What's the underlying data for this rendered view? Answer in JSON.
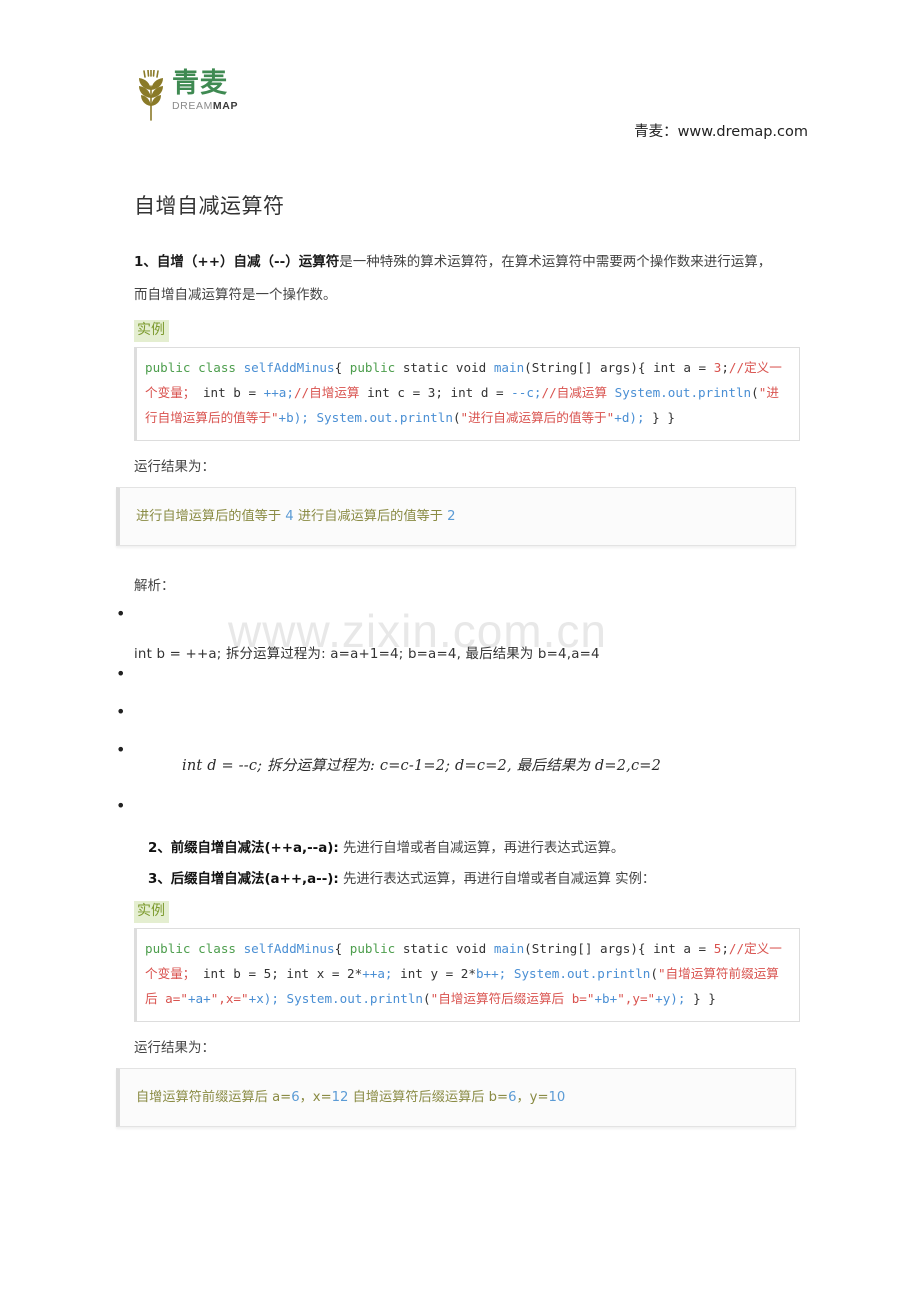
{
  "header": {
    "logo_cn": "青麦",
    "logo_en_light": "DREAM",
    "logo_en_bold": "MAP",
    "site_link": "青麦：www.dremap.com"
  },
  "watermark": "www.zixin.com.cn",
  "doc": {
    "title": "自增自减运算符",
    "intro_bold": "1、自增（++）自减（--）运算符",
    "intro_rest": "是一种特殊的算术运算符，在算术运算符中需要两个操作数来进行运算，",
    "intro_line2": "而自增自减运算符是一个操作数。",
    "example_tag": "实例",
    "result_label": "运行结果为：",
    "analysis_label": "解析："
  },
  "code1": {
    "tokens": [
      {
        "t": "public ",
        "c": "k"
      },
      {
        "t": "class ",
        "c": "k"
      },
      {
        "t": "selfAddMinus",
        "c": "cls"
      },
      {
        "t": "{ ",
        "c": "pl"
      },
      {
        "t": "public ",
        "c": "k"
      },
      {
        "t": "static ",
        "c": "pl"
      },
      {
        "t": "void ",
        "c": "pl"
      },
      {
        "t": "main",
        "c": "cls"
      },
      {
        "t": "(String[] args){ int a = ",
        "c": "pl"
      },
      {
        "t": "3",
        "c": "cm"
      },
      {
        "t": ";",
        "c": "pl"
      },
      {
        "t": "//定义一个变量；",
        "c": "cm"
      },
      {
        "t": " int b = ",
        "c": "pl"
      },
      {
        "t": "++a;",
        "c": "cls"
      },
      {
        "t": "//自增运算",
        "c": "cm"
      },
      {
        "t": " int c = 3; int d = ",
        "c": "pl"
      },
      {
        "t": "--c;",
        "c": "cls"
      },
      {
        "t": "//自减运算",
        "c": "cm"
      },
      {
        "t": " ",
        "c": "pl"
      },
      {
        "t": "System.out.println",
        "c": "cls"
      },
      {
        "t": "(",
        "c": "pl"
      },
      {
        "t": "\"进行自增运算后的值等于\"",
        "c": "cm"
      },
      {
        "t": "+b); ",
        "c": "cls"
      },
      {
        "t": "System.out.println",
        "c": "cls"
      },
      {
        "t": "(",
        "c": "pl"
      },
      {
        "t": "\"进行自减运算后的值等于\"",
        "c": "cm"
      },
      {
        "t": "+d); ",
        "c": "cls"
      },
      {
        "t": "} }",
        "c": "pl"
      }
    ],
    "plain": "public class selfAddMinus{ public static void main(String[] args){ int a = 3;//定义一个变量； int b = ++a;//自增运算 int c = 3; int d = --c;//自减运算 System.out.println(\"进行自增运算后的值等于\"+b); System.out.println(\"进行自减运算后的值等于\"+d); } }"
  },
  "result1": {
    "seg1": "进行自增运算后的值等于 ",
    "num1": "4",
    "seg2": " 进行自减运算后的值等于 ",
    "num2": "2"
  },
  "analysis": {
    "bullet1": "int b = ++a; 拆分运算过程为: a=a+1=4; b=a=4, 最后结果为 b=4,a=4",
    "bullet2": "int d = --c; 拆分运算过程为: c=c-1=2; d=c=2, 最后结果为 d=2,c=2"
  },
  "section2": {
    "bold": "2、前缀自增自减法(++a,--a):",
    "rest": " 先进行自增或者自减运算，再进行表达式运算。"
  },
  "section3": {
    "bold": "3、后缀自增自减法(a++,a--):",
    "rest": " 先进行表达式运算，再进行自增或者自减运算 实例："
  },
  "code2": {
    "tokens": [
      {
        "t": "public ",
        "c": "k"
      },
      {
        "t": "class ",
        "c": "k"
      },
      {
        "t": "selfAddMinus",
        "c": "cls"
      },
      {
        "t": "{ ",
        "c": "pl"
      },
      {
        "t": "public ",
        "c": "k"
      },
      {
        "t": "static ",
        "c": "pl"
      },
      {
        "t": "void ",
        "c": "pl"
      },
      {
        "t": "main",
        "c": "cls"
      },
      {
        "t": "(String[] args){ int a = ",
        "c": "pl"
      },
      {
        "t": "5",
        "c": "cm"
      },
      {
        "t": ";",
        "c": "pl"
      },
      {
        "t": "//定义一个变量；",
        "c": "cm"
      },
      {
        "t": " int b = 5; int x = 2*",
        "c": "pl"
      },
      {
        "t": "++a;",
        "c": "cls"
      },
      {
        "t": " int y = 2*",
        "c": "pl"
      },
      {
        "t": "b++;",
        "c": "cls"
      },
      {
        "t": " ",
        "c": "pl"
      },
      {
        "t": "System.out.println",
        "c": "cls"
      },
      {
        "t": "(",
        "c": "pl"
      },
      {
        "t": "\"自增运算符前缀运算后 a=\"",
        "c": "cm"
      },
      {
        "t": "+a+",
        "c": "cls"
      },
      {
        "t": "\",x=\"",
        "c": "cm"
      },
      {
        "t": "+x); ",
        "c": "cls"
      },
      {
        "t": "System.out.println",
        "c": "cls"
      },
      {
        "t": "(",
        "c": "pl"
      },
      {
        "t": "\"自增运算符后缀运算后 b=\"",
        "c": "cm"
      },
      {
        "t": "+b+",
        "c": "cls"
      },
      {
        "t": "\",y=\"",
        "c": "cm"
      },
      {
        "t": "+y); ",
        "c": "cls"
      },
      {
        "t": "} }",
        "c": "pl"
      }
    ],
    "plain": "public class selfAddMinus{ public static void main(String[] args){ int a = 5;//定义一个变量； int b = 5; int x = 2*++a; int y = 2*b++; System.out.println(\"自增运算符前缀运算后 a=\"+a+\",x=\"+x); System.out.println(\"自增运算符后缀运算后 b=\"+b+\",y=\"+y); } }"
  },
  "result2": {
    "seg1": "自增运算符前缀运算后 a=",
    "num1": "6",
    "seg2": "，x=",
    "num2": "12",
    "seg3": " 自增运算符后缀运算后 b=",
    "num3": "6",
    "seg4": "，y=",
    "num4": "10"
  },
  "colors": {
    "brand_green": "#3f8a52",
    "logo_gold": "#8a7a28",
    "keyword": "#4d9e4d",
    "identifier": "#4a8fd4",
    "comment": "#d9534f",
    "result_text": "#8a8b44",
    "result_number": "#5b9bd5",
    "example_bg": "#e4eed0",
    "example_fg": "#7d9b2f"
  }
}
